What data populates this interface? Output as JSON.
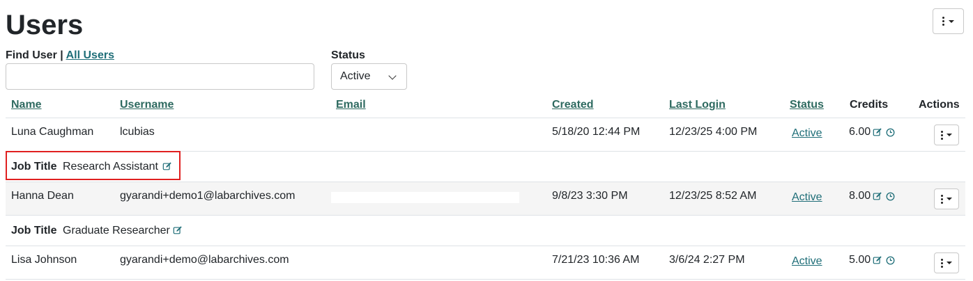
{
  "page": {
    "title": "Users"
  },
  "filters": {
    "find_label": "Find User",
    "separator": "|",
    "all_users_link": "All Users",
    "find_value": "",
    "status_label": "Status",
    "status_selected": "Active"
  },
  "table": {
    "headers": {
      "name": "Name",
      "username": "Username",
      "email": "Email",
      "created": "Created",
      "last_login": "Last Login",
      "status": "Status",
      "credits": "Credits",
      "actions": "Actions"
    },
    "rows": [
      {
        "name": "Luna Caughman",
        "username": "lcubias",
        "created": "5/18/20 12:44 PM",
        "last_login": "12/23/25 4:00 PM",
        "status": "Active",
        "credits": "6.00",
        "job_title_label": "Job Title",
        "job_title": "Research Assistant"
      },
      {
        "name": "Hanna Dean",
        "username": "gyarandi+demo1@labarchives.com",
        "created": "9/8/23 3:30 PM",
        "last_login": "12/23/25 8:52 AM",
        "status": "Active",
        "credits": "8.00",
        "job_title_label": "Job Title",
        "job_title": "Graduate Researcher"
      },
      {
        "name": "Lisa Johnson",
        "username": "gyarandi+demo@labarchives.com",
        "created": "7/21/23 10:36 AM",
        "last_login": "3/6/24 2:27 PM",
        "status": "Active",
        "credits": "5.00"
      }
    ]
  },
  "colors": {
    "link": "#1f6e78",
    "header_link": "#2e6a60",
    "highlight": "#e02020",
    "icon": "#1f6e78"
  }
}
